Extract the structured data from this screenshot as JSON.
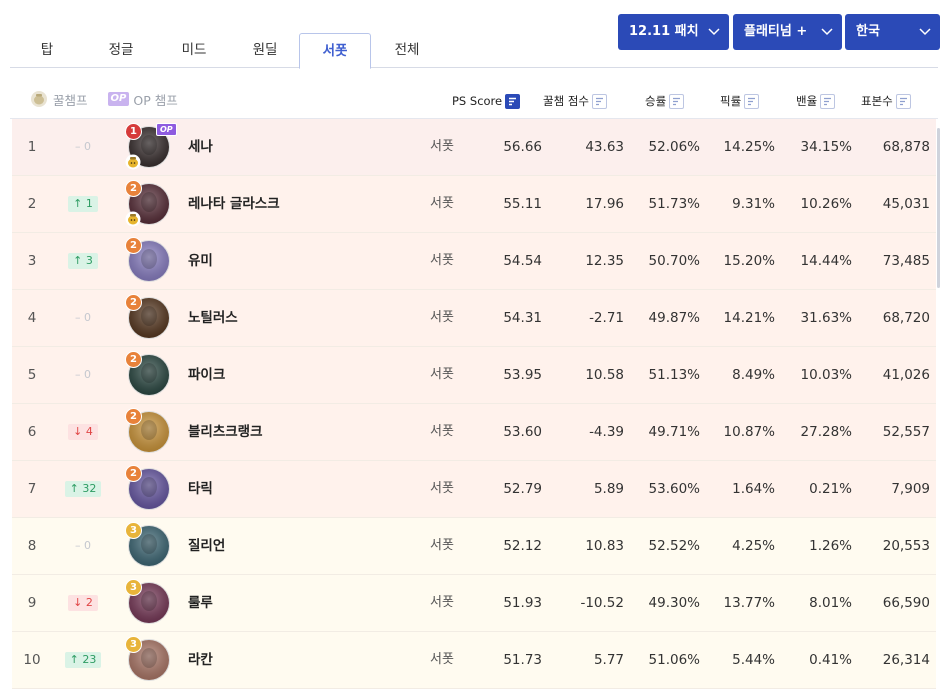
{
  "tabs": [
    {
      "label": "탑",
      "active": false
    },
    {
      "label": "정글",
      "active": false
    },
    {
      "label": "미드",
      "active": false
    },
    {
      "label": "원딜",
      "active": false
    },
    {
      "label": "서폿",
      "active": true
    },
    {
      "label": "전체",
      "active": false
    }
  ],
  "dropdowns": {
    "patch": "12.11 패치",
    "tier": "플래티넘 +",
    "region": "한국"
  },
  "filters": {
    "honey": "꿀챔프",
    "op_badge": "OP",
    "op": "OP 챔프"
  },
  "headers": {
    "ps_score": "PS Score",
    "honey_score": "꿀챔 점수",
    "win_rate": "승률",
    "pick_rate": "픽률",
    "ban_rate": "밴율",
    "sample": "표본수"
  },
  "colors": {
    "accent": "#2b4ab7",
    "tier1_bg": "#fcefed",
    "tier2_bg": "#fff2ec",
    "tier3_bg": "#fffbf0",
    "up": "#2e9c63",
    "down": "#e04545"
  },
  "rows": [
    {
      "rank": "1",
      "change": "0",
      "dir": "same",
      "tier": "1",
      "honey": true,
      "op": true,
      "op_label": "OP",
      "name": "세나",
      "role": "서폿",
      "ps": "56.66",
      "hs": "43.63",
      "wr": "52.06%",
      "pr": "14.25%",
      "br": "34.15%",
      "sm": "68,878",
      "portrait": "#3a3030"
    },
    {
      "rank": "2",
      "change": "1",
      "dir": "up",
      "tier": "2",
      "honey": true,
      "op": false,
      "name": "레나타 글라스크",
      "role": "서폿",
      "ps": "55.11",
      "hs": "17.96",
      "wr": "51.73%",
      "pr": "9.31%",
      "br": "10.26%",
      "sm": "45,031",
      "portrait": "#5a2f3a"
    },
    {
      "rank": "3",
      "change": "3",
      "dir": "up",
      "tier": "2",
      "honey": false,
      "op": false,
      "name": "유미",
      "role": "서폿",
      "ps": "54.54",
      "hs": "12.35",
      "wr": "50.70%",
      "pr": "15.20%",
      "br": "14.44%",
      "sm": "73,485",
      "portrait": "#8d82c8"
    },
    {
      "rank": "4",
      "change": "0",
      "dir": "same",
      "tier": "2",
      "honey": false,
      "op": false,
      "name": "노틸러스",
      "role": "서폿",
      "ps": "54.31",
      "hs": "-2.71",
      "wr": "49.87%",
      "pr": "14.21%",
      "br": "31.63%",
      "sm": "68,720",
      "portrait": "#5a3a22"
    },
    {
      "rank": "5",
      "change": "0",
      "dir": "same",
      "tier": "2",
      "honey": false,
      "op": false,
      "name": "파이크",
      "role": "서폿",
      "ps": "53.95",
      "hs": "10.58",
      "wr": "51.13%",
      "pr": "8.49%",
      "br": "10.03%",
      "sm": "41,026",
      "portrait": "#2c4a44"
    },
    {
      "rank": "6",
      "change": "4",
      "dir": "down",
      "tier": "2",
      "honey": false,
      "op": false,
      "name": "블리츠크랭크",
      "role": "서폿",
      "ps": "53.60",
      "hs": "-4.39",
      "wr": "49.71%",
      "pr": "10.87%",
      "br": "27.28%",
      "sm": "52,557",
      "portrait": "#d29a3c"
    },
    {
      "rank": "7",
      "change": "32",
      "dir": "up",
      "tier": "2",
      "honey": false,
      "op": false,
      "name": "타릭",
      "role": "서폿",
      "ps": "52.79",
      "hs": "5.89",
      "wr": "53.60%",
      "pr": "1.64%",
      "br": "0.21%",
      "sm": "7,909",
      "portrait": "#6a5aa8"
    },
    {
      "rank": "8",
      "change": "0",
      "dir": "same",
      "tier": "3",
      "honey": false,
      "op": false,
      "name": "질리언",
      "role": "서폿",
      "ps": "52.12",
      "hs": "10.83",
      "wr": "52.52%",
      "pr": "4.25%",
      "br": "1.26%",
      "sm": "20,553",
      "portrait": "#3f6a78"
    },
    {
      "rank": "9",
      "change": "2",
      "dir": "down",
      "tier": "3",
      "honey": false,
      "op": false,
      "name": "룰루",
      "role": "서폿",
      "ps": "51.93",
      "hs": "-10.52",
      "wr": "49.30%",
      "pr": "13.77%",
      "br": "8.01%",
      "sm": "66,590",
      "portrait": "#7a3a5a"
    },
    {
      "rank": "10",
      "change": "23",
      "dir": "up",
      "tier": "3",
      "honey": false,
      "op": false,
      "name": "라칸",
      "role": "서폿",
      "ps": "51.73",
      "hs": "5.77",
      "wr": "51.06%",
      "pr": "5.44%",
      "br": "0.41%",
      "sm": "26,314",
      "portrait": "#b07a6a"
    }
  ]
}
